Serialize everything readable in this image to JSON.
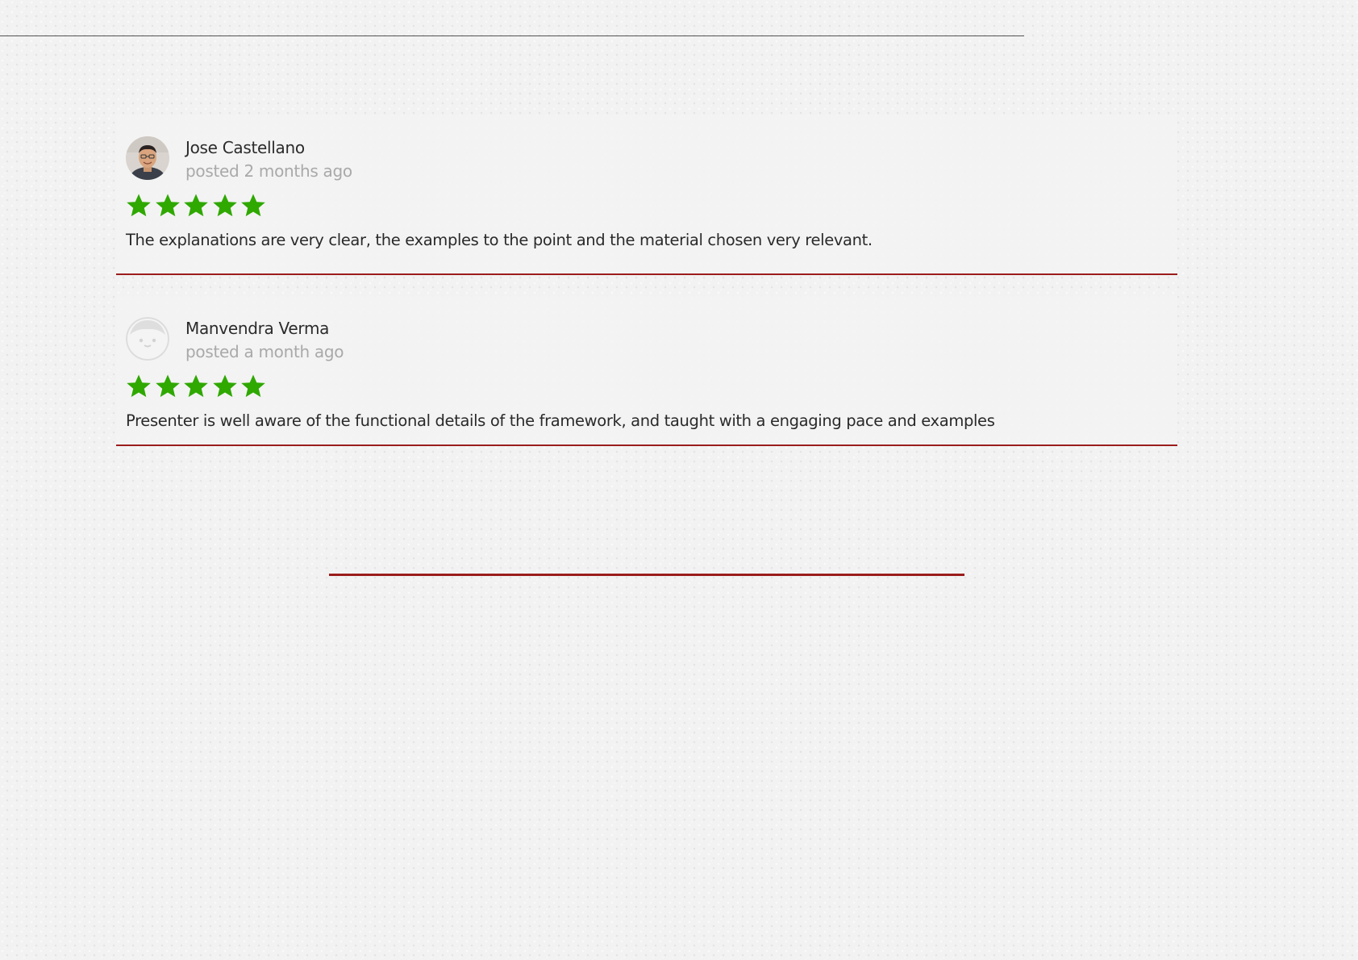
{
  "reviews": [
    {
      "name": "Jose Castellano",
      "posted": "posted 2 months ago",
      "rating": 5,
      "max_rating": 5,
      "comment": "The explanations are very clear, the examples to the point and the material chosen very relevant.",
      "avatar_icon": "user-photo-icon"
    },
    {
      "name": "Manvendra Verma",
      "posted": "posted a month ago",
      "rating": 5,
      "max_rating": 5,
      "comment": "Presenter is well aware of the functional details of the framework, and taught with a engaging pace and examples",
      "avatar_icon": "default-avatar-icon"
    }
  ],
  "colors": {
    "star": "#2fa800",
    "divider": "#9b1c1c",
    "muted_text": "#a9a9a9",
    "card_background": "#f3f3f3"
  }
}
